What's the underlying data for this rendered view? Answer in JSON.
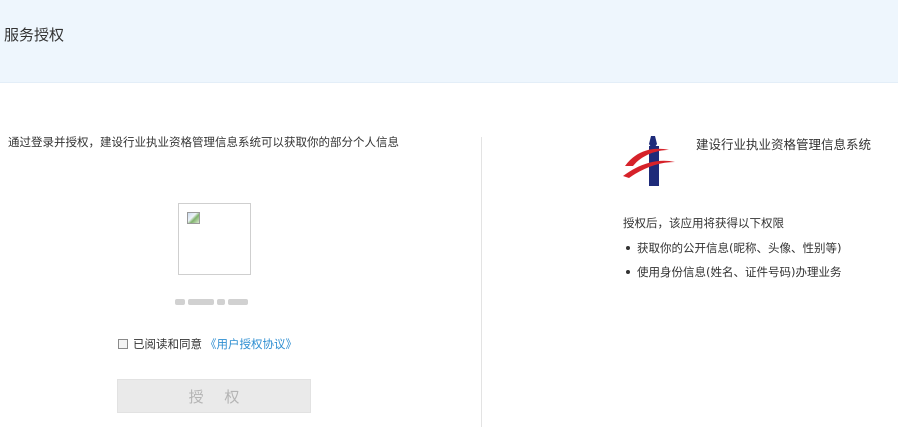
{
  "header": {
    "title": "服务授权"
  },
  "left": {
    "intro": "通过登录并授权，建设行业执业资格管理信息系统可以获取你的部分个人信息",
    "agree_text": "已阅读和同意",
    "agree_link": "《用户授权协议》",
    "authorize_button": "授 权"
  },
  "right": {
    "system_name": "建设行业执业资格管理信息系统",
    "permissions_intro": "授权后，该应用将获得以下权限",
    "permissions": [
      "获取你的公开信息(昵称、头像、性别等)",
      "使用身份信息(姓名、证件号码)办理业务"
    ]
  },
  "colors": {
    "header_bg": "#eef6fd",
    "link": "#2f8fd2",
    "button_bg": "#eaeaea",
    "logo_blue": "#1e2b7a",
    "logo_red": "#d6222a"
  },
  "icons": [
    "broken-image-icon",
    "checkbox-icon",
    "system-logo-icon",
    "bullet-icon"
  ]
}
